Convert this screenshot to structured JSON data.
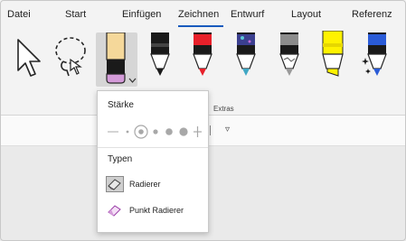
{
  "ribbon": {
    "tabs": [
      {
        "label": "Datei"
      },
      {
        "label": "Start"
      },
      {
        "label": "Einfügen"
      },
      {
        "label": "Zeichnen",
        "active": true
      },
      {
        "label": "Entwurf"
      },
      {
        "label": "Layout"
      },
      {
        "label": "Referenz"
      }
    ],
    "group_label": "Extras",
    "accent_color": "#185abd"
  },
  "tools": [
    {
      "icon": "select-pointer-icon"
    },
    {
      "icon": "lasso-select-icon"
    },
    {
      "icon": "eraser-tool-icon",
      "selected": true
    },
    {
      "icon": "black-pen-icon",
      "color": "#1a1a1a"
    },
    {
      "icon": "red-pen-icon",
      "color": "#e8202a"
    },
    {
      "icon": "galaxy-pen-icon",
      "color": "#3b3f8f"
    },
    {
      "icon": "silver-pen-icon",
      "color": "#8c8c8c"
    },
    {
      "icon": "yellow-highlighter-icon",
      "color": "#fff200"
    },
    {
      "icon": "action-pen-icon",
      "color": "#2a5bd7"
    }
  ],
  "dropdown": {
    "thickness_heading": "Stärke",
    "thickness_options": [
      "thinnest",
      "thin",
      "medium-selected",
      "thick",
      "thicker",
      "thickest"
    ],
    "types_heading": "Typen",
    "types": [
      {
        "label": "Radierer",
        "icon": "stroke-eraser-icon",
        "selected": true
      },
      {
        "label": "Punkt Radierer",
        "icon": "point-eraser-icon",
        "selected": false
      }
    ]
  }
}
